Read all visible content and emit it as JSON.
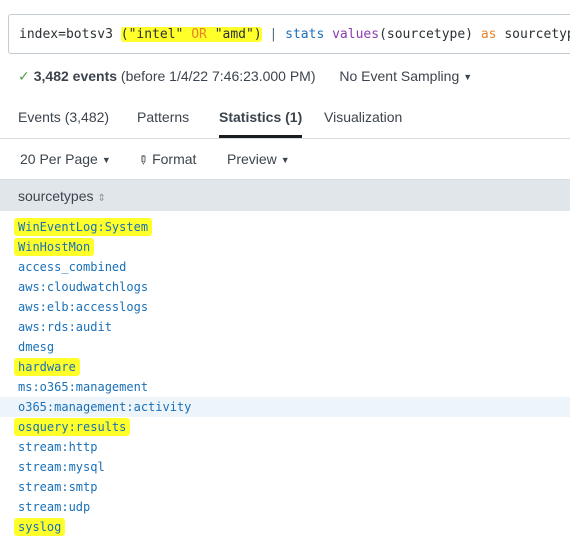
{
  "search": {
    "index": "index=botsv3 ",
    "paren_open": "(",
    "term1": "\"intel\"",
    "op": "OR",
    "term2": "\"amd\"",
    "paren_close": ")",
    "pipe": "|",
    "cmd": "stats",
    "fn": "values",
    "arg": "(sourcetype)",
    "kw": "as",
    "alias": "sourcetypes"
  },
  "summary": {
    "check": "✓",
    "count": "3,482 events",
    "range": "(before 1/4/22 7:46:23.000 PM)",
    "sampling": "No Event Sampling"
  },
  "tabs": [
    {
      "label": "Events (3,482)",
      "active": false
    },
    {
      "label": "Patterns",
      "active": false
    },
    {
      "label": "Statistics (1)",
      "active": true
    },
    {
      "label": "Visualization",
      "active": false
    }
  ],
  "toolbar": {
    "per_page": "20 Per Page",
    "format": "Format",
    "preview": "Preview"
  },
  "table": {
    "header": "sourcetypes",
    "values": [
      {
        "text": "WinEventLog:System",
        "highlight": true
      },
      {
        "text": "WinHostMon",
        "highlight": true
      },
      {
        "text": "access_combined",
        "highlight": false
      },
      {
        "text": "aws:cloudwatchlogs",
        "highlight": false
      },
      {
        "text": "aws:elb:accesslogs",
        "highlight": false
      },
      {
        "text": "aws:rds:audit",
        "highlight": false
      },
      {
        "text": "dmesg",
        "highlight": false
      },
      {
        "text": "hardware",
        "highlight": true
      },
      {
        "text": "ms:o365:management",
        "highlight": false
      },
      {
        "text": "o365:management:activity",
        "highlight": false
      },
      {
        "text": "osquery:results",
        "highlight": true
      },
      {
        "text": "stream:http",
        "highlight": false
      },
      {
        "text": "stream:mysql",
        "highlight": false
      },
      {
        "text": "stream:smtp",
        "highlight": false
      },
      {
        "text": "stream:udp",
        "highlight": false
      },
      {
        "text": "syslog",
        "highlight": true
      }
    ]
  },
  "colors": {
    "highlight": "#ffff2a",
    "link": "#1a70b8",
    "success": "#53a051"
  }
}
